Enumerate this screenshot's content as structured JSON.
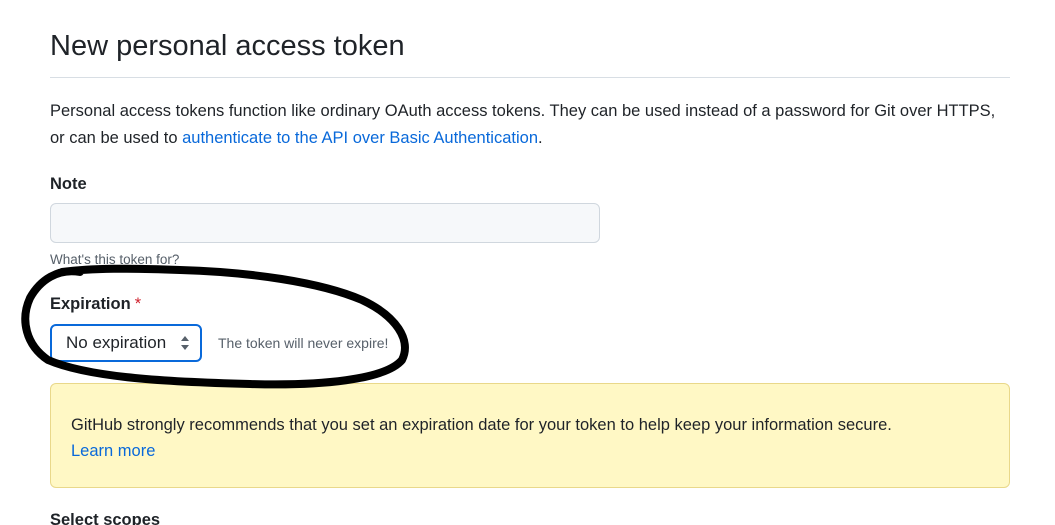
{
  "header": {
    "title": "New personal access token"
  },
  "intro": {
    "text": "Personal access tokens function like ordinary OAuth access tokens. They can be used instead of a password for Git over HTTPS, or can be used to ",
    "link_text": "authenticate to the API over Basic Authentication",
    "suffix": "."
  },
  "note": {
    "label": "Note",
    "value": "",
    "hint": "What's this token for?"
  },
  "expiration": {
    "label": "Expiration",
    "required_marker": "*",
    "selected": "No expiration",
    "hint": "The token will never expire!"
  },
  "warning": {
    "text": "GitHub strongly recommends that you set an expiration date for your token to help keep your information secure.",
    "link_text": "Learn more"
  },
  "scopes": {
    "label": "Select scopes"
  },
  "colors": {
    "link": "#0969da",
    "warning_bg": "#fff8c5",
    "required": "#cf222e",
    "annotation_stroke": "#000000"
  },
  "icons": {
    "select_chevron": "chevron-up-down-icon"
  }
}
